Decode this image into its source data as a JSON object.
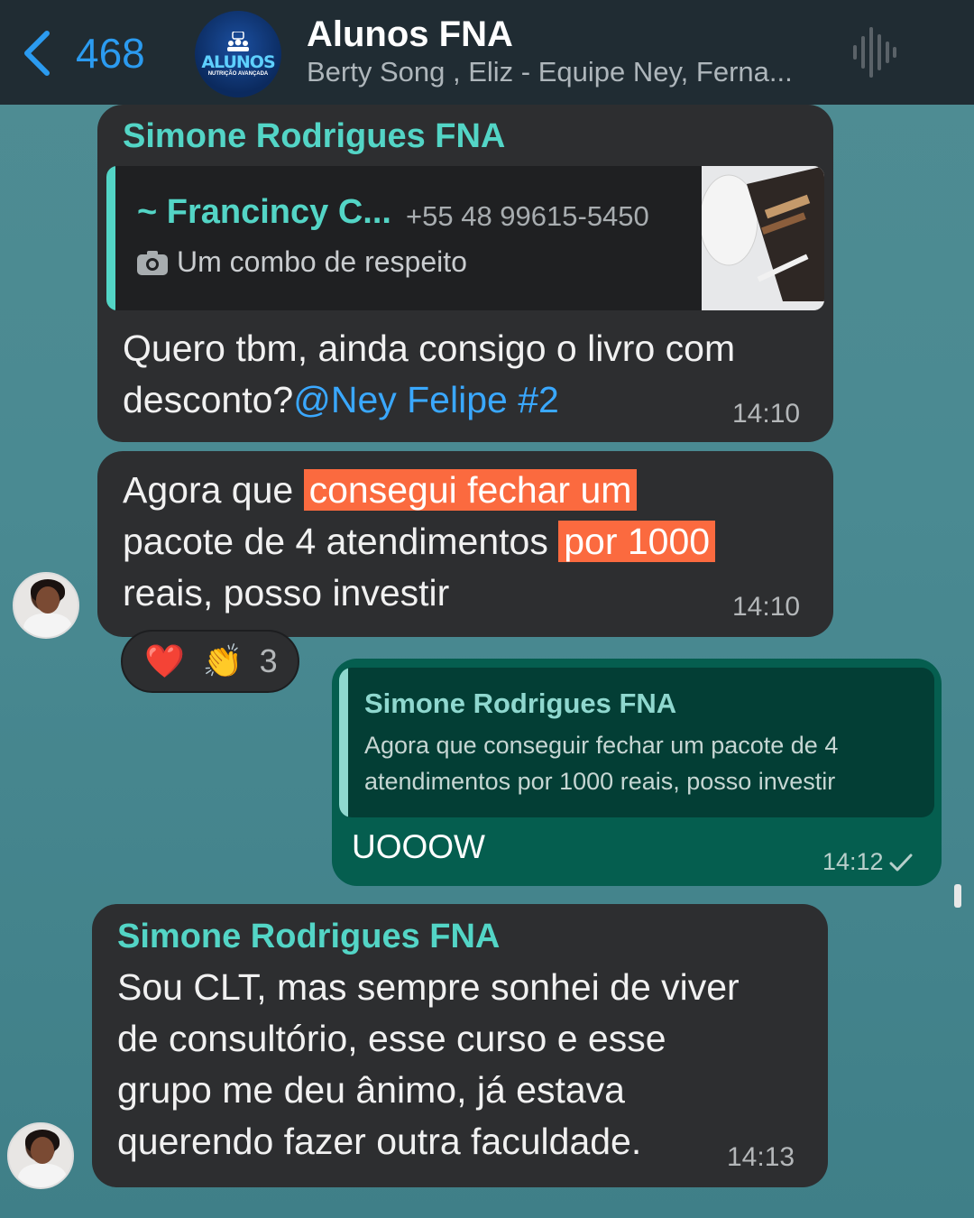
{
  "header": {
    "back_count": "468",
    "group_name": "Alunos FNA",
    "members": "Berty Song , Eliz - Equipe Ney, Ferna...",
    "logo_word": "ALUNOS",
    "logo_sub": "NUTRIÇÃO AVANÇADA"
  },
  "messages": [
    {
      "sender": "Simone Rodrigues FNA",
      "quote": {
        "name": "~ Francincy C...",
        "phone": "+55 48 99615-5450",
        "text": "Um combo de respeito"
      },
      "text_line1": "Quero tbm, ainda consigo o livro com",
      "text_line2_a": "desconto?",
      "mention": "@Ney Felipe #2",
      "time": "14:10"
    },
    {
      "l1_a": "Agora que ",
      "l1_hl": "consegui  fechar um",
      "l2_a": "pacote de 4 atendimentos ",
      "l2_hl": "por 1000",
      "l3": "reais, posso investir",
      "time": "14:10",
      "reactions": {
        "emoji1": "❤️",
        "emoji2": "👏",
        "count": "3"
      }
    },
    {
      "quote_name": "Simone Rodrigues FNA",
      "quote_text": "Agora que conseguir fechar um pacote de 4 atendimentos por 1000 reais, posso investir",
      "text": "UOOOW",
      "time": "14:12"
    },
    {
      "sender": "Simone Rodrigues FNA",
      "l1": "Sou CLT, mas sempre sonhei de viver",
      "l2": "de consultório, esse curso e esse",
      "l3": "grupo me deu ânimo, já estava",
      "l4": "querendo fazer outra faculdade.",
      "time": "14:13"
    }
  ],
  "colors": {
    "accent": "#2b9bf0",
    "sender": "#53d5c6",
    "highlight": "#fb6a3f",
    "outgoing": "#055e4f"
  }
}
